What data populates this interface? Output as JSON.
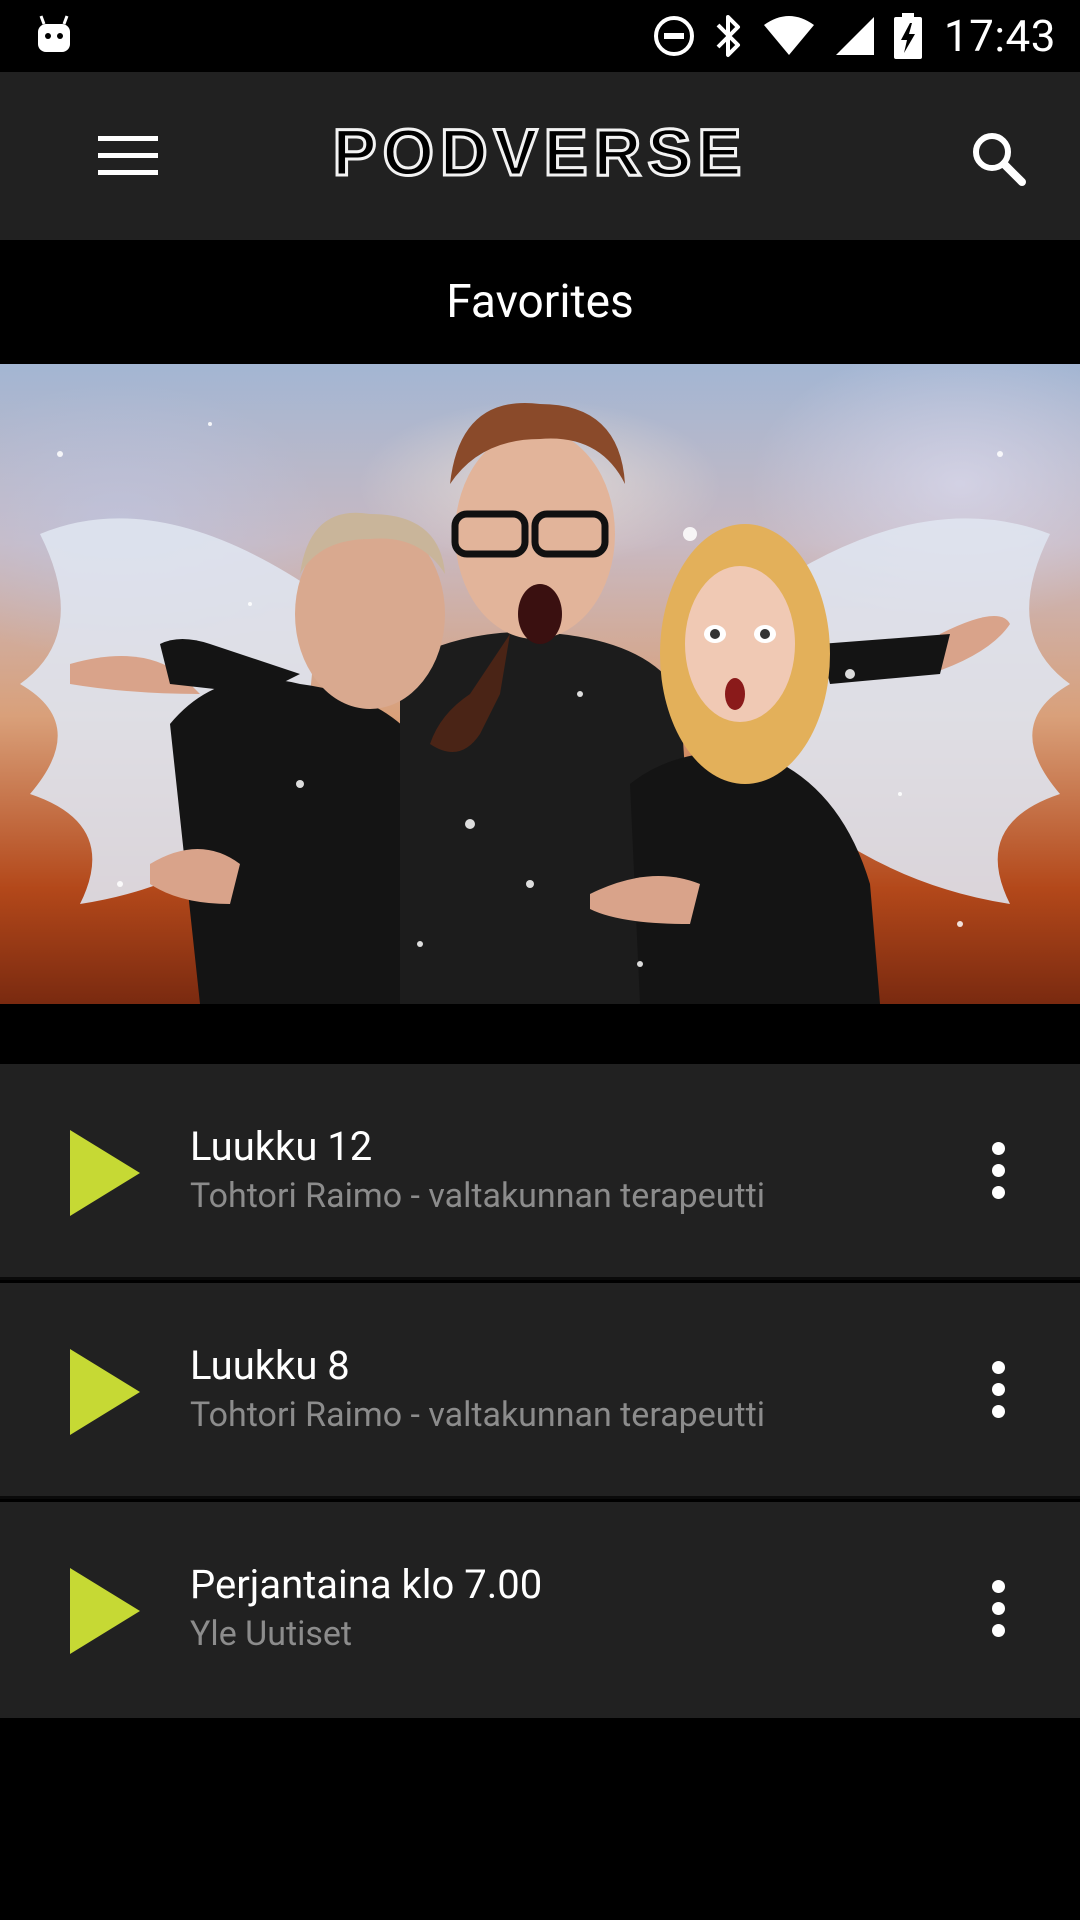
{
  "status_bar": {
    "time": "17:43",
    "icons": [
      "android-debug-icon",
      "do-not-disturb-icon",
      "bluetooth-icon",
      "wifi-icon",
      "cellular-signal-icon",
      "battery-charging-icon"
    ]
  },
  "app_bar": {
    "logo_text": "PODVERSE",
    "menu_icon": "hamburger-menu-icon",
    "search_icon": "search-icon"
  },
  "page": {
    "title": "Favorites"
  },
  "hero": {
    "description": "podcast artwork"
  },
  "episodes": [
    {
      "title": "Luukku 12",
      "podcast": "Tohtori Raimo - valtakunnan terapeutti"
    },
    {
      "title": "Luukku 8",
      "podcast": "Tohtori Raimo - valtakunnan terapeutti"
    },
    {
      "title": "Perjantaina klo 7.00",
      "podcast": "Yle Uutiset"
    }
  ],
  "colors": {
    "accent_play": "#c6d934",
    "app_bar_bg": "#212121",
    "list_bg": "#212121",
    "subtitle_text": "#8c8c8c"
  }
}
